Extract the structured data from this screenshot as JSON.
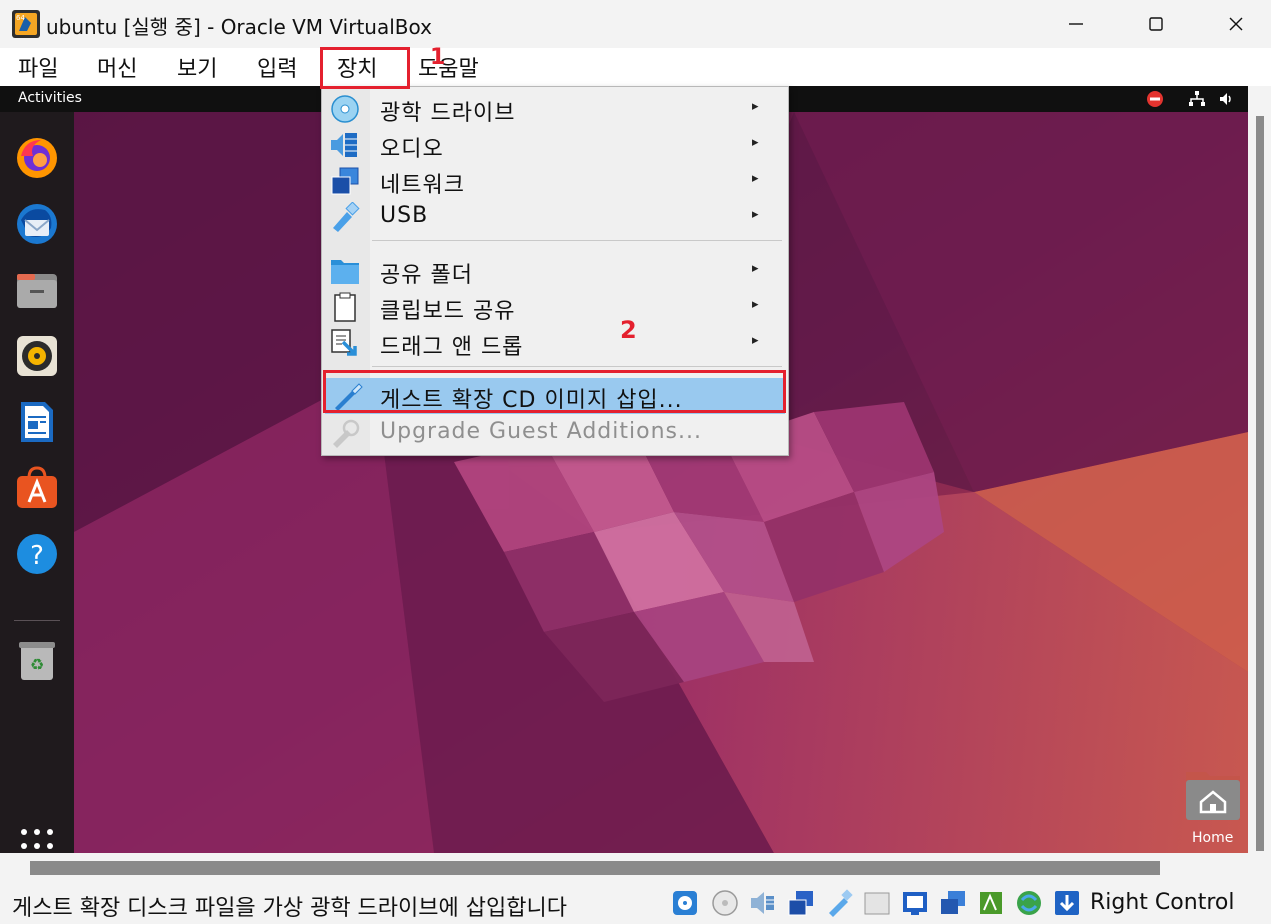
{
  "window": {
    "title": "ubuntu [실행 중] - Oracle VM VirtualBox"
  },
  "menubar": {
    "items": [
      "파일",
      "머신",
      "보기",
      "입력",
      "장치",
      "도움말"
    ]
  },
  "annotations": {
    "step1": "1",
    "step2": "2",
    "color": "#e4202e"
  },
  "guest": {
    "activities": "Activities",
    "home_label": "Home",
    "dock_apps": [
      "firefox-icon",
      "thunderbird-icon",
      "files-icon",
      "rhythmbox-icon",
      "libreoffice-writer-icon",
      "app-center-icon",
      "help-icon",
      "trash-icon"
    ]
  },
  "devices_menu": {
    "items": [
      {
        "label": "광학 드라이브",
        "icon": "optical-disc-icon",
        "submenu": true
      },
      {
        "label": "오디오",
        "icon": "audio-icon",
        "submenu": true
      },
      {
        "label": "네트워크",
        "icon": "network-icon",
        "submenu": true
      },
      {
        "label": "USB",
        "icon": "usb-icon",
        "submenu": true
      },
      {
        "label": "공유 폴더",
        "icon": "shared-folder-icon",
        "submenu": true
      },
      {
        "label": "클립보드 공유",
        "icon": "clipboard-icon",
        "submenu": true
      },
      {
        "label": "드래그 앤 드롭",
        "icon": "drag-drop-icon",
        "submenu": true
      },
      {
        "label": "게스트 확장 CD 이미지 삽입...",
        "icon": "guest-additions-icon",
        "submenu": false,
        "highlighted": true
      },
      {
        "label": "Upgrade Guest Additions...",
        "icon": "upgrade-guest-additions-icon",
        "submenu": false,
        "disabled": true
      }
    ],
    "arrow": "▸"
  },
  "statusbar": {
    "message": "게스트 확장 디스크 파일을 가상 광학 드라이브에 삽입합니다",
    "host_key": "Right Control"
  },
  "colors": {
    "highlight": "#99c9ef",
    "menu_bg": "#f0f0f0"
  }
}
